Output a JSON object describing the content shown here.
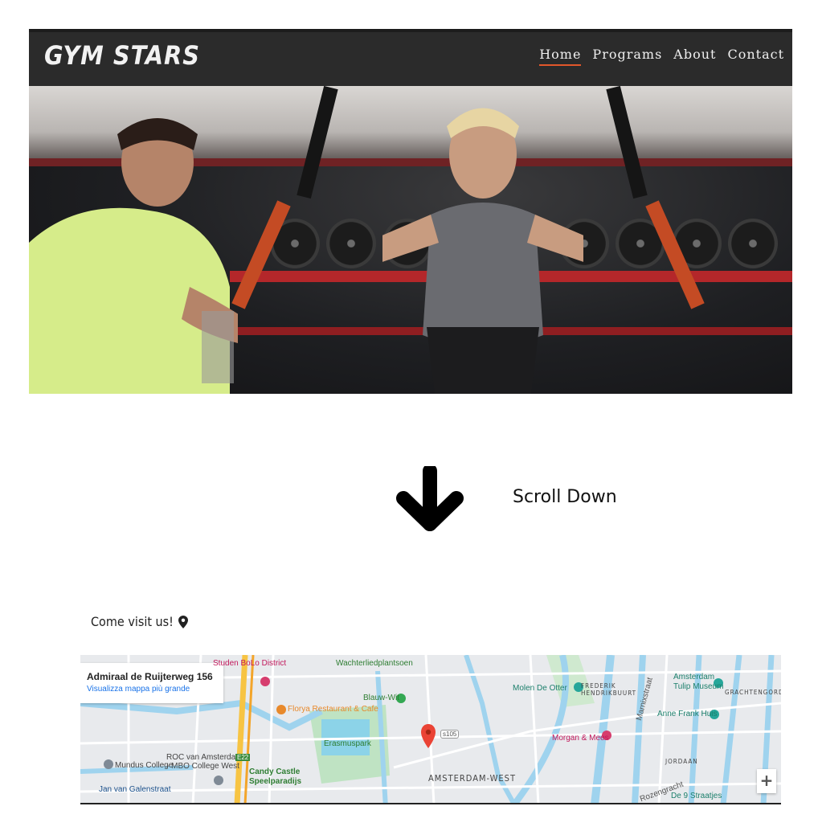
{
  "header": {
    "logo": "GYM STARS",
    "nav": [
      {
        "label": "Home",
        "active": true
      },
      {
        "label": "Programs",
        "active": false
      },
      {
        "label": "About",
        "active": false
      },
      {
        "label": "Contact",
        "active": false
      }
    ],
    "accent_color": "#e2572b"
  },
  "hero": {
    "image": "gym-training-photo"
  },
  "scroll": {
    "label": "Scroll Down",
    "icon": "arrow-down-icon"
  },
  "visit": {
    "title": "Come visit us!",
    "icon": "map-pin-icon"
  },
  "map": {
    "address_title": "Admiraal de Ruijterweg 156",
    "view_larger_link": "Visualizza mappa più grande",
    "zoom_in": "+",
    "labels": {
      "bolo": "Studen BoLo District",
      "wachter": "Wachterliedplantsoen",
      "molen": "Molen De Otter",
      "frederik": "FREDERIK\nHENDRIKBUURT",
      "marnixstraat": "Marnixstraat",
      "amsterdam_tulip": "Amsterdam\nTulip Museum",
      "grachtengordel": "GRACHTENGORDEL-W",
      "blauw": "Blauw-Wit",
      "florya": "Florya Restaurant & Cafe",
      "erasmuspark": "Erasmuspark",
      "anne": "Anne Frank Huis",
      "morgan": "Morgan & Mees",
      "jordaan": "JORDAAN",
      "mundus": "Mundus College",
      "roc": "ROC van Amsterdam\n- MBO College West",
      "candy": "Candy Castle\nSpeelparadijs",
      "amsterdam_west": "AMSTERDAM-WEST",
      "jan_van": "Jan van Galenstraat",
      "rozengracht": "Rozengracht",
      "negen": "De 9 Straatjes",
      "s105": "s105",
      "e22": "E22"
    }
  }
}
